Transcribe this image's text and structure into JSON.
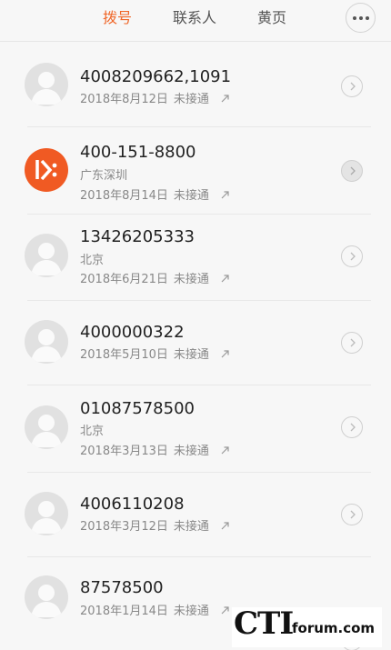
{
  "tabs": {
    "dial": "拨号",
    "contacts": "联系人",
    "yellow_pages": "黄页"
  },
  "colors": {
    "accent": "#f0682a",
    "brand_avatar": "#f05a23"
  },
  "calls": [
    {
      "number": "4008209662,1091",
      "location": "",
      "date": "2018年8月12日",
      "status": "未接通",
      "avatar": "default"
    },
    {
      "number": "400-151-8800",
      "location": "广东深圳",
      "date": "2018年8月14日",
      "status": "未接通",
      "avatar": "brand-logo"
    },
    {
      "number": "13426205333",
      "location": "北京",
      "date": "2018年6月21日",
      "status": "未接通",
      "avatar": "default"
    },
    {
      "number": "4000000322",
      "location": "",
      "date": "2018年5月10日",
      "status": "未接通",
      "avatar": "default"
    },
    {
      "number": "01087578500",
      "location": "北京",
      "date": "2018年3月13日",
      "status": "未接通",
      "avatar": "default"
    },
    {
      "number": "4006110208",
      "location": "",
      "date": "2018年3月12日",
      "status": "未接通",
      "avatar": "default"
    },
    {
      "number": "87578500",
      "location": "",
      "date": "2018年1月14日",
      "status": "未接通",
      "avatar": "default"
    }
  ],
  "watermark": {
    "logo": "CTI",
    "domain": "forum.com"
  }
}
